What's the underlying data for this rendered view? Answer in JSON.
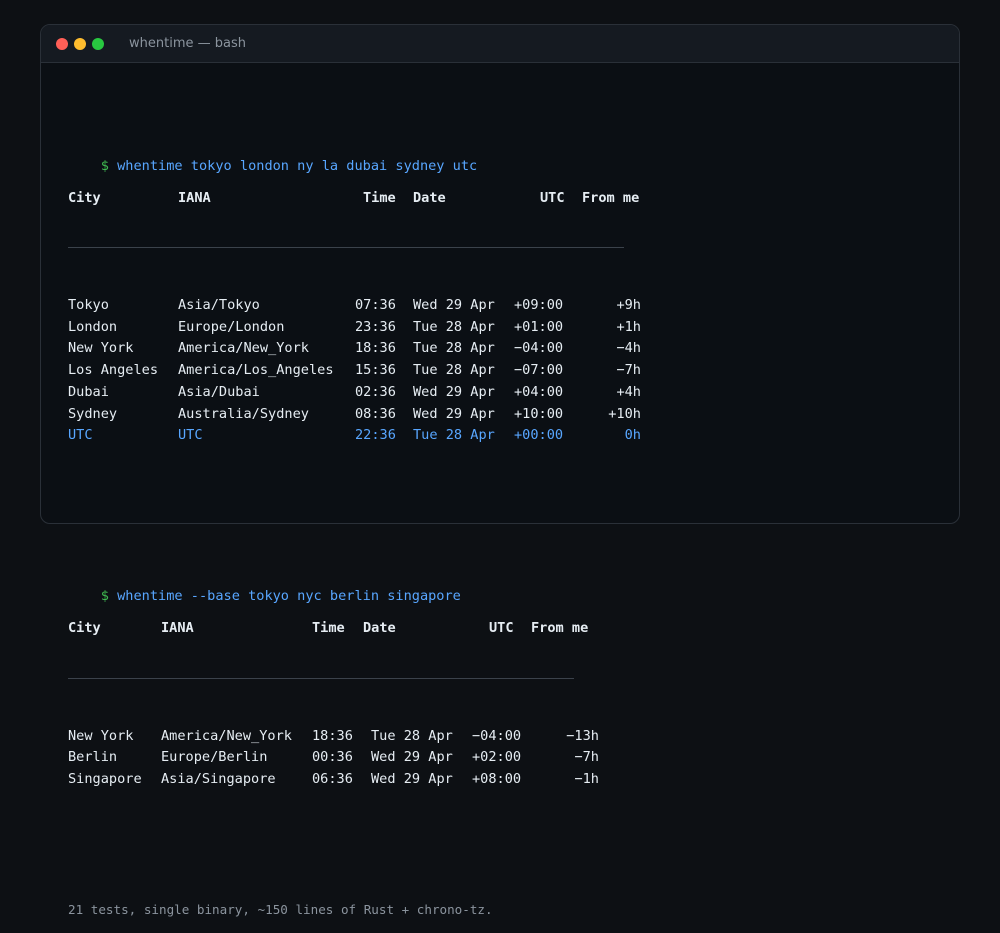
{
  "window": {
    "title": "whentime — bash"
  },
  "block1": {
    "prompt": "$",
    "command": "whentime tokyo london ny la dubai sydney utc",
    "headers": {
      "city": "City",
      "iana": "IANA",
      "time": "Time",
      "date": "Date",
      "utc": "UTC",
      "from": "From me"
    },
    "rows": [
      {
        "city": "Tokyo",
        "iana": "Asia/Tokyo",
        "time": "07:36",
        "date": "Wed 29 Apr",
        "utc": "+09:00",
        "from": "+9h"
      },
      {
        "city": "London",
        "iana": "Europe/London",
        "time": "23:36",
        "date": "Tue 28 Apr",
        "utc": "+01:00",
        "from": "+1h"
      },
      {
        "city": "New York",
        "iana": "America/New_York",
        "time": "18:36",
        "date": "Tue 28 Apr",
        "utc": "−04:00",
        "from": "−4h"
      },
      {
        "city": "Los Angeles",
        "iana": "America/Los_Angeles",
        "time": "15:36",
        "date": "Tue 28 Apr",
        "utc": "−07:00",
        "from": "−7h"
      },
      {
        "city": "Dubai",
        "iana": "Asia/Dubai",
        "time": "02:36",
        "date": "Wed 29 Apr",
        "utc": "+04:00",
        "from": "+4h"
      },
      {
        "city": "Sydney",
        "iana": "Australia/Sydney",
        "time": "08:36",
        "date": "Wed 29 Apr",
        "utc": "+10:00",
        "from": "+10h"
      },
      {
        "city": "UTC",
        "iana": "UTC",
        "time": "22:36",
        "date": "Tue 28 Apr",
        "utc": "+00:00",
        "from": "0h"
      }
    ]
  },
  "block2": {
    "prompt": "$",
    "command": "whentime --base tokyo nyc berlin singapore",
    "headers": {
      "city": "City",
      "iana": "IANA",
      "time": "Time",
      "date": "Date",
      "utc": "UTC",
      "from": "From me"
    },
    "rows": [
      {
        "city": "New York",
        "iana": "America/New_York",
        "time": "18:36",
        "date": "Tue 28 Apr",
        "utc": "−04:00",
        "from": "−13h"
      },
      {
        "city": "Berlin",
        "iana": "Europe/Berlin",
        "time": "00:36",
        "date": "Wed 29 Apr",
        "utc": "+02:00",
        "from": "−7h"
      },
      {
        "city": "Singapore",
        "iana": "Asia/Singapore",
        "time": "06:36",
        "date": "Wed 29 Apr",
        "utc": "+08:00",
        "from": "−1h"
      }
    ]
  },
  "footer": "21 tests, single binary, ~150 lines of Rust + chrono-tz.",
  "colors": {
    "prompt": "#3fb950",
    "command": "#58a6ff",
    "highlight_row": "#58a6ff"
  }
}
